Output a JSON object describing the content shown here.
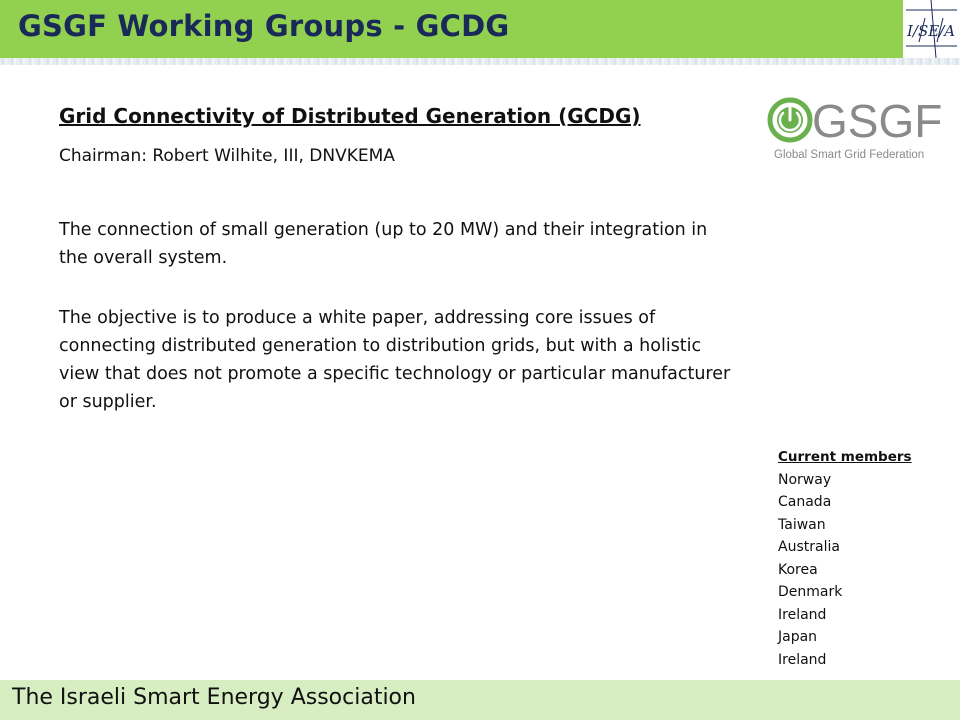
{
  "header": {
    "title": "GSGF Working Groups - GCDG",
    "logo_text": "I/SE/A"
  },
  "content": {
    "section_title": "Grid Connectivity of Distributed Generation (GCDG)",
    "chairman": "Chairman: Robert Wilhite, III, DNVKEMA",
    "paragraph1": "The connection of small generation (up to 20 MW) and their integration in the overall system.",
    "paragraph2": "The objective is to produce a white paper, addressing core issues of connecting distributed generation to distribution grids, but with a holistic view that does not promote a specific technology or particular manufacturer or supplier."
  },
  "gsgf_logo": {
    "wordmark": "GSGF",
    "tagline": "Global Smart Grid Federation"
  },
  "members": {
    "header": "Current members",
    "items": [
      "Norway",
      "Canada",
      "Taiwan",
      "Australia",
      "Korea",
      "Denmark",
      "Ireland",
      "Japan",
      "Ireland"
    ]
  },
  "footer": {
    "text": "The Israeli Smart Energy Association"
  },
  "colors": {
    "header_bg": "#92d050",
    "title_text": "#1a2a58",
    "footer_bg": "#d6eec2",
    "logo_green": "#6ab04c",
    "logo_gray": "#8a8a8a"
  }
}
